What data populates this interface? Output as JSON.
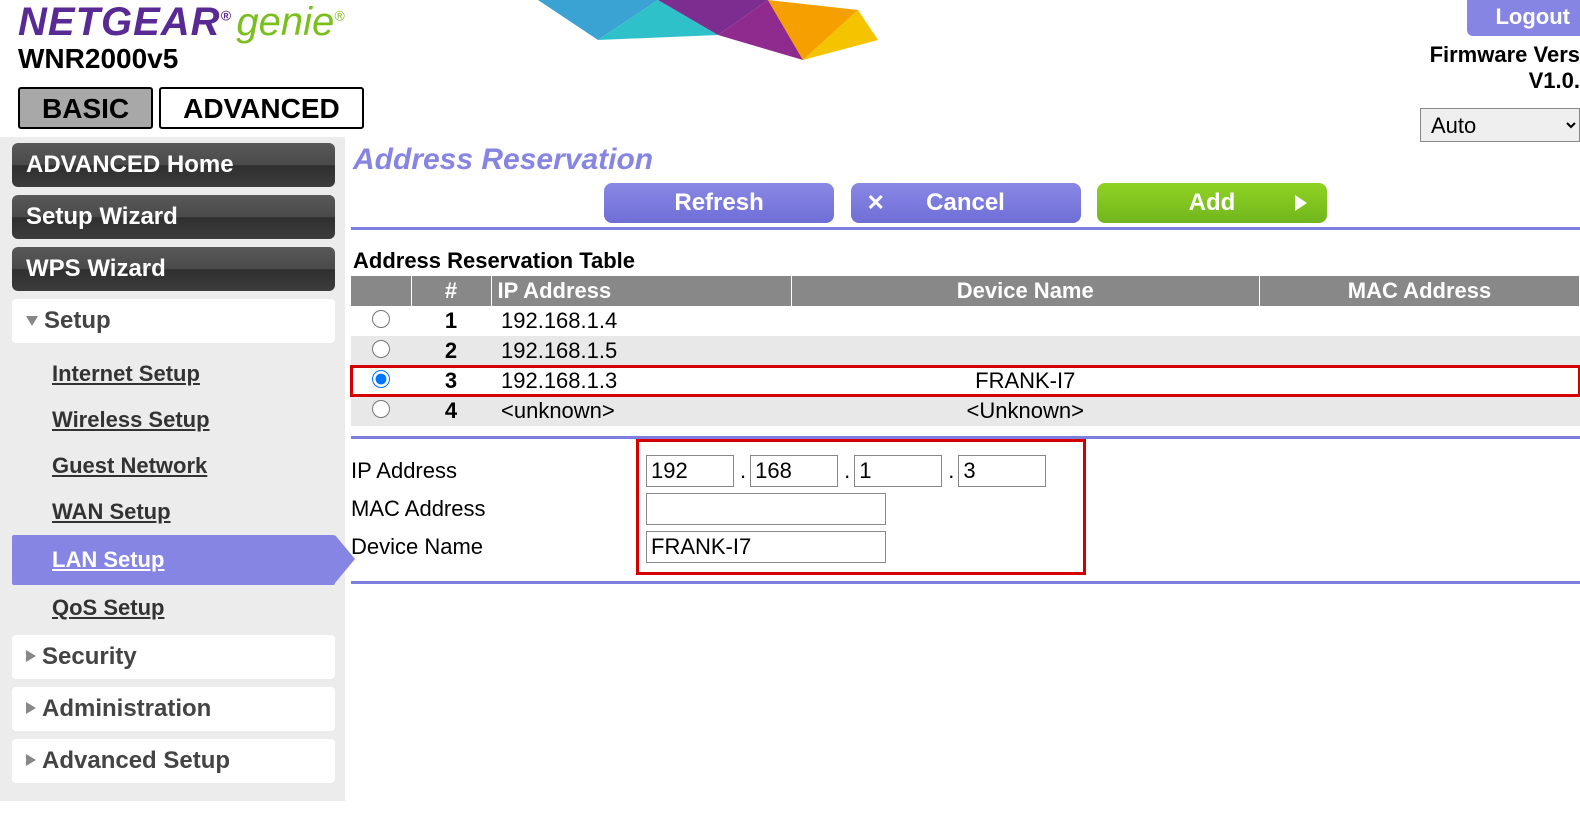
{
  "header": {
    "brand_netgear": "NETGEAR",
    "brand_genie": "genie",
    "model": "WNR2000v5",
    "logout": "Logout",
    "fw_label": "Firmware Vers",
    "fw_value": "V1.0.",
    "lang": "Auto"
  },
  "tabs": {
    "basic": "BASIC",
    "advanced": "ADVANCED"
  },
  "sidebar": {
    "adv_home": "ADVANCED Home",
    "setup_wizard": "Setup Wizard",
    "wps_wizard": "WPS Wizard",
    "setup_label": "Setup",
    "sub": {
      "internet": "Internet Setup",
      "wireless": "Wireless Setup",
      "guest": "Guest Network",
      "wan": "WAN Setup",
      "lan": "LAN Setup",
      "qos": "QoS Setup"
    },
    "security": "Security",
    "admin": "Administration",
    "adv_setup": "Advanced Setup"
  },
  "main": {
    "title": "Address Reservation",
    "btn_refresh": "Refresh",
    "btn_cancel": "Cancel",
    "btn_add": "Add",
    "table_title": "Address Reservation Table",
    "cols": {
      "num": "#",
      "ip": "IP Address",
      "dev": "Device Name",
      "mac": "MAC Address"
    },
    "rows": [
      {
        "n": "1",
        "ip": "192.168.1.4",
        "dev": "",
        "mac": "",
        "selected": false
      },
      {
        "n": "2",
        "ip": "192.168.1.5",
        "dev": "",
        "mac": "",
        "selected": false
      },
      {
        "n": "3",
        "ip": "192.168.1.3",
        "dev": "FRANK-I7",
        "mac": "",
        "selected": true
      },
      {
        "n": "4",
        "ip": "<unknown>",
        "dev": "<Unknown>",
        "mac": "",
        "selected": false
      }
    ],
    "form": {
      "ip_label": "IP Address",
      "mac_label": "MAC Address",
      "dev_label": "Device Name",
      "ip": [
        "192",
        "168",
        "1",
        "3"
      ],
      "mac": "",
      "dev": "FRANK-I7"
    }
  }
}
